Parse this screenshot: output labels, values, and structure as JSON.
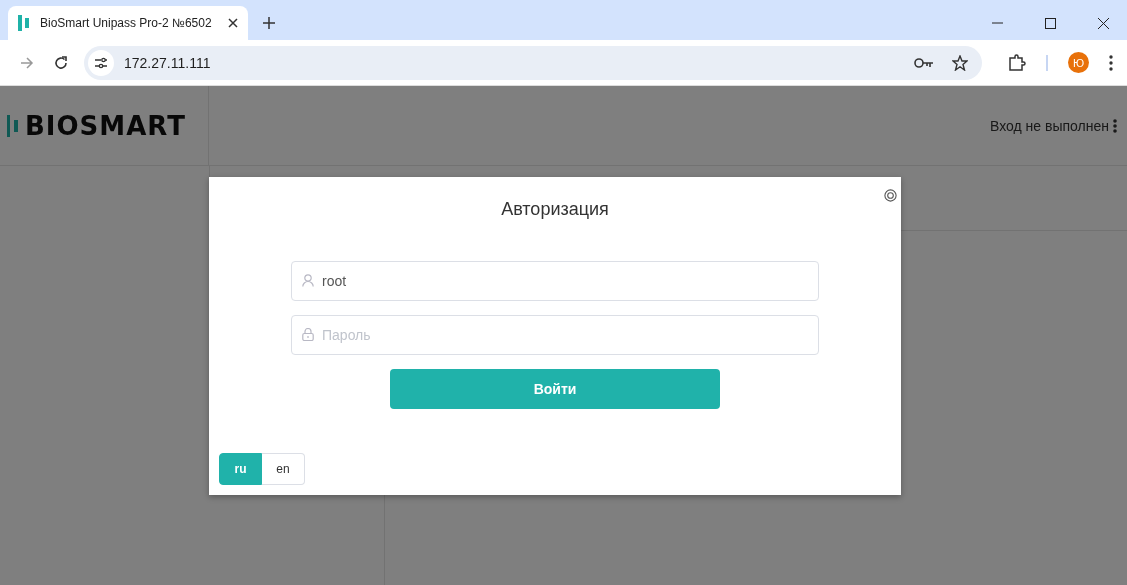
{
  "browser": {
    "tab": {
      "title": "BioSmart Unipass Pro-2 №6502"
    },
    "address": "172.27.11.111",
    "profile_initial": "Ю"
  },
  "header": {
    "logo": "BIOSMART",
    "login_status": "Вход не выполнен"
  },
  "dialog": {
    "title": "Авторизация",
    "username": {
      "value": "root"
    },
    "password": {
      "placeholder": "Пароль"
    },
    "submit": "Войти",
    "languages": [
      {
        "label": "ru",
        "selected": true
      },
      {
        "label": "en",
        "selected": false
      }
    ]
  }
}
